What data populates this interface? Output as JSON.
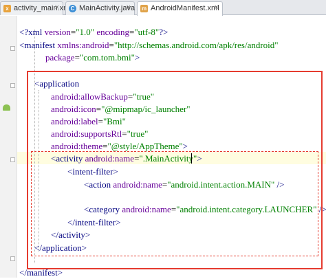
{
  "tabs": [
    {
      "label": "activity_main.xml",
      "icon": "xml-file-icon",
      "active": false,
      "close": "×"
    },
    {
      "label": "MainActivity.java",
      "icon": "java-class-icon",
      "active": false,
      "close": "×"
    },
    {
      "label": "AndroidManifest.xml",
      "icon": "manifest-file-icon",
      "active": true,
      "close": "×"
    }
  ],
  "code": {
    "l1": {
      "open": "<?xml ",
      "a1": "version",
      "eq1": "=",
      "v1": "\"1.0\"",
      "sp": " ",
      "a2": "encoding",
      "eq2": "=",
      "v2": "\"utf-8\"",
      "close": "?>"
    },
    "l2": {
      "open": "<manifest ",
      "a1": "xmlns:android",
      "eq": "=",
      "v1": "\"http://schemas.android.com/apk/res/android\""
    },
    "l3": {
      "a1": "package",
      "eq": "=",
      "v1": "\"com.tom.bmi\"",
      "close": ">"
    },
    "l4": {
      "open": "<application"
    },
    "l5": {
      "a1": "android:allowBackup",
      "eq": "=",
      "v1": "\"true\""
    },
    "l6": {
      "a1": "android:icon",
      "eq": "=",
      "v1": "\"@mipmap/ic_launcher\""
    },
    "l7": {
      "a1": "android:label",
      "eq": "=",
      "v1": "\"Bmi\""
    },
    "l8": {
      "a1": "android:supportsRtl",
      "eq": "=",
      "v1": "\"true\""
    },
    "l9": {
      "a1": "android:theme",
      "eq": "=",
      "v1": "\"@style/AppTheme\"",
      "close": ">"
    },
    "l10": {
      "open": "<activity ",
      "a1": "android:name",
      "eq": "=",
      "v1": "\".MainActivity\"",
      "close": ">"
    },
    "l11": {
      "open": "<intent-filter>"
    },
    "l12": {
      "open": "<action ",
      "a1": "android:name",
      "eq": "=",
      "v1": "\"android.intent.action.MAIN\"",
      "close": " />"
    },
    "l13": {
      "open": "<category ",
      "a1": "android:name",
      "eq": "=",
      "v1": "\"android.intent.category.LAUNCHER\"",
      "close": " />"
    },
    "l14": {
      "open": "</intent-filter>"
    },
    "l15": {
      "open": "</activity>"
    },
    "l16": {
      "open": "</application>"
    },
    "l17": {
      "open": "</manifest>"
    }
  },
  "colors": {
    "tag": "#000080",
    "attribute": "#660099",
    "value": "#008000",
    "highlight": "#e53b2f",
    "current_line": "#fffde0"
  }
}
